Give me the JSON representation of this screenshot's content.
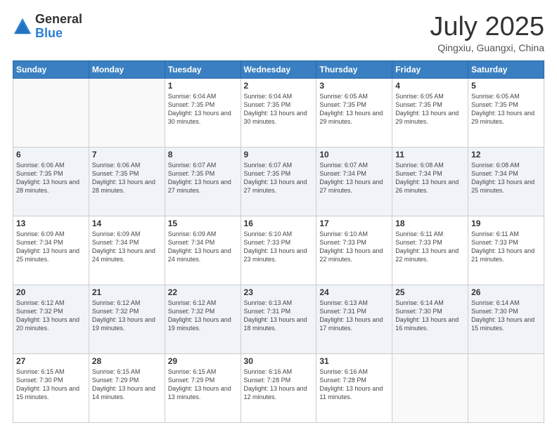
{
  "header": {
    "logo_general": "General",
    "logo_blue": "Blue",
    "month_title": "July 2025",
    "location": "Qingxiu, Guangxi, China"
  },
  "weekdays": [
    "Sunday",
    "Monday",
    "Tuesday",
    "Wednesday",
    "Thursday",
    "Friday",
    "Saturday"
  ],
  "weeks": [
    [
      {
        "day": "",
        "info": ""
      },
      {
        "day": "",
        "info": ""
      },
      {
        "day": "1",
        "info": "Sunrise: 6:04 AM\nSunset: 7:35 PM\nDaylight: 13 hours and 30 minutes."
      },
      {
        "day": "2",
        "info": "Sunrise: 6:04 AM\nSunset: 7:35 PM\nDaylight: 13 hours and 30 minutes."
      },
      {
        "day": "3",
        "info": "Sunrise: 6:05 AM\nSunset: 7:35 PM\nDaylight: 13 hours and 29 minutes."
      },
      {
        "day": "4",
        "info": "Sunrise: 6:05 AM\nSunset: 7:35 PM\nDaylight: 13 hours and 29 minutes."
      },
      {
        "day": "5",
        "info": "Sunrise: 6:05 AM\nSunset: 7:35 PM\nDaylight: 13 hours and 29 minutes."
      }
    ],
    [
      {
        "day": "6",
        "info": "Sunrise: 6:06 AM\nSunset: 7:35 PM\nDaylight: 13 hours and 28 minutes."
      },
      {
        "day": "7",
        "info": "Sunrise: 6:06 AM\nSunset: 7:35 PM\nDaylight: 13 hours and 28 minutes."
      },
      {
        "day": "8",
        "info": "Sunrise: 6:07 AM\nSunset: 7:35 PM\nDaylight: 13 hours and 27 minutes."
      },
      {
        "day": "9",
        "info": "Sunrise: 6:07 AM\nSunset: 7:35 PM\nDaylight: 13 hours and 27 minutes."
      },
      {
        "day": "10",
        "info": "Sunrise: 6:07 AM\nSunset: 7:34 PM\nDaylight: 13 hours and 27 minutes."
      },
      {
        "day": "11",
        "info": "Sunrise: 6:08 AM\nSunset: 7:34 PM\nDaylight: 13 hours and 26 minutes."
      },
      {
        "day": "12",
        "info": "Sunrise: 6:08 AM\nSunset: 7:34 PM\nDaylight: 13 hours and 25 minutes."
      }
    ],
    [
      {
        "day": "13",
        "info": "Sunrise: 6:09 AM\nSunset: 7:34 PM\nDaylight: 13 hours and 25 minutes."
      },
      {
        "day": "14",
        "info": "Sunrise: 6:09 AM\nSunset: 7:34 PM\nDaylight: 13 hours and 24 minutes."
      },
      {
        "day": "15",
        "info": "Sunrise: 6:09 AM\nSunset: 7:34 PM\nDaylight: 13 hours and 24 minutes."
      },
      {
        "day": "16",
        "info": "Sunrise: 6:10 AM\nSunset: 7:33 PM\nDaylight: 13 hours and 23 minutes."
      },
      {
        "day": "17",
        "info": "Sunrise: 6:10 AM\nSunset: 7:33 PM\nDaylight: 13 hours and 22 minutes."
      },
      {
        "day": "18",
        "info": "Sunrise: 6:11 AM\nSunset: 7:33 PM\nDaylight: 13 hours and 22 minutes."
      },
      {
        "day": "19",
        "info": "Sunrise: 6:11 AM\nSunset: 7:33 PM\nDaylight: 13 hours and 21 minutes."
      }
    ],
    [
      {
        "day": "20",
        "info": "Sunrise: 6:12 AM\nSunset: 7:32 PM\nDaylight: 13 hours and 20 minutes."
      },
      {
        "day": "21",
        "info": "Sunrise: 6:12 AM\nSunset: 7:32 PM\nDaylight: 13 hours and 19 minutes."
      },
      {
        "day": "22",
        "info": "Sunrise: 6:12 AM\nSunset: 7:32 PM\nDaylight: 13 hours and 19 minutes."
      },
      {
        "day": "23",
        "info": "Sunrise: 6:13 AM\nSunset: 7:31 PM\nDaylight: 13 hours and 18 minutes."
      },
      {
        "day": "24",
        "info": "Sunrise: 6:13 AM\nSunset: 7:31 PM\nDaylight: 13 hours and 17 minutes."
      },
      {
        "day": "25",
        "info": "Sunrise: 6:14 AM\nSunset: 7:30 PM\nDaylight: 13 hours and 16 minutes."
      },
      {
        "day": "26",
        "info": "Sunrise: 6:14 AM\nSunset: 7:30 PM\nDaylight: 13 hours and 15 minutes."
      }
    ],
    [
      {
        "day": "27",
        "info": "Sunrise: 6:15 AM\nSunset: 7:30 PM\nDaylight: 13 hours and 15 minutes."
      },
      {
        "day": "28",
        "info": "Sunrise: 6:15 AM\nSunset: 7:29 PM\nDaylight: 13 hours and 14 minutes."
      },
      {
        "day": "29",
        "info": "Sunrise: 6:15 AM\nSunset: 7:29 PM\nDaylight: 13 hours and 13 minutes."
      },
      {
        "day": "30",
        "info": "Sunrise: 6:16 AM\nSunset: 7:28 PM\nDaylight: 13 hours and 12 minutes."
      },
      {
        "day": "31",
        "info": "Sunrise: 6:16 AM\nSunset: 7:28 PM\nDaylight: 13 hours and 11 minutes."
      },
      {
        "day": "",
        "info": ""
      },
      {
        "day": "",
        "info": ""
      }
    ]
  ]
}
